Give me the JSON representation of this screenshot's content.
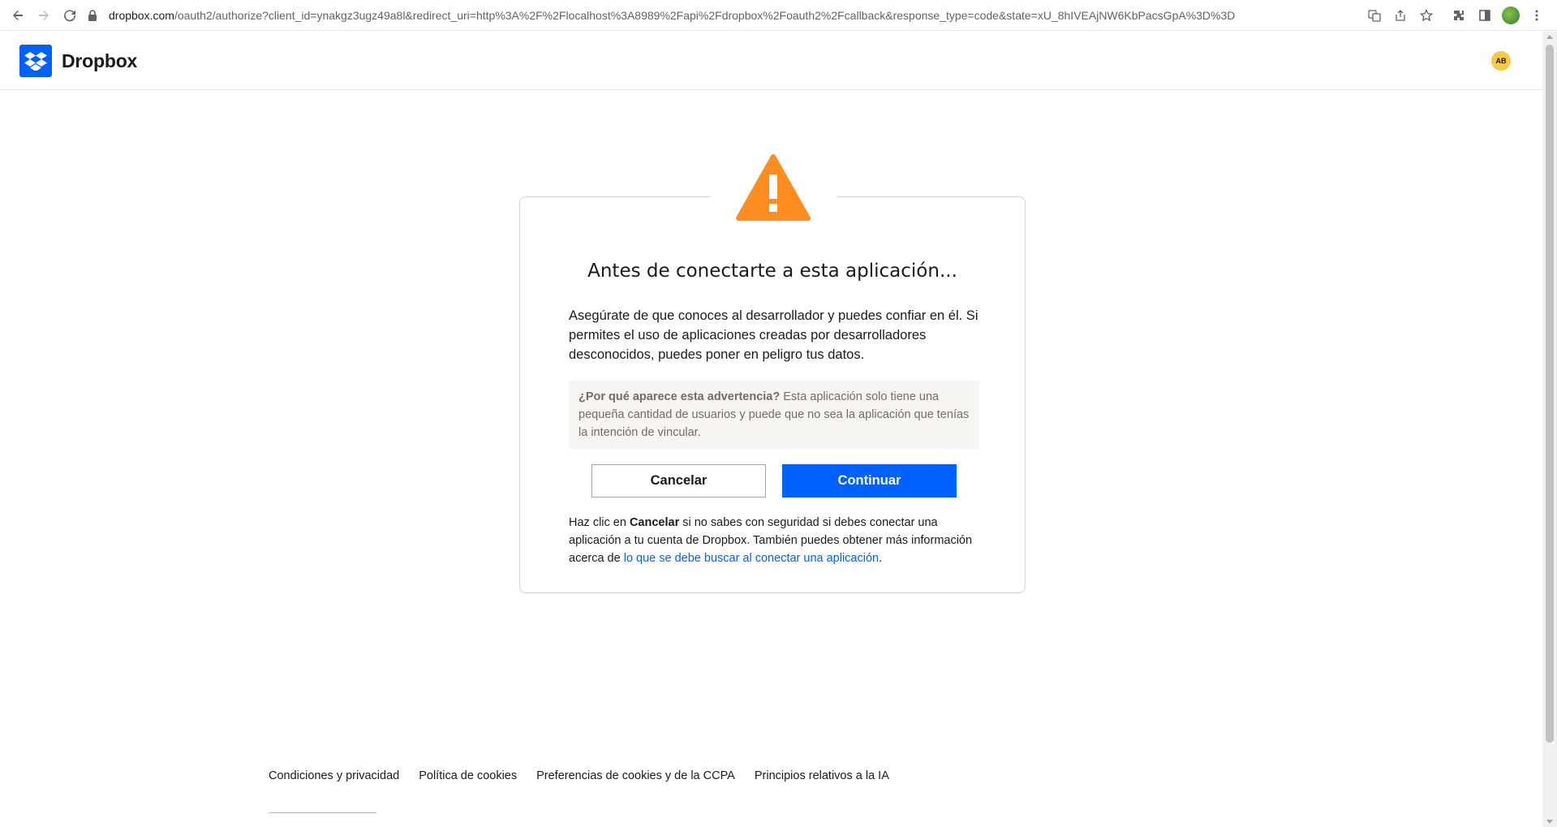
{
  "browser": {
    "url_host": "dropbox.com",
    "url_rest": "/oauth2/authorize?client_id=ynakgz3ugz49a8l&redirect_uri=http%3A%2F%2Flocalhost%3A8989%2Fapi%2Fdropbox%2Foauth2%2Fcallback&response_type=code&state=xU_8hIVEAjNW6KbPacsGpA%3D%3D"
  },
  "header": {
    "brand": "Dropbox",
    "avatar_initials": "AB",
    "brand_color": "#0061fe",
    "avatar_color": "#f7c948"
  },
  "card": {
    "warning_color": "#fe8c21",
    "title": "Antes de conectarte a esta aplicación...",
    "body": "Asegúrate de que conoces al desarrollador y puedes confiar en él. Si permites el uso de aplicaciones creadas por desarrolladores desconocidos, puedes poner en peligro tus datos.",
    "why_label": "¿Por qué aparece esta advertencia?",
    "why_text": " Esta aplicación solo tiene una pequeña cantidad de usuarios y puede que no sea la aplicación que tenías la intención de vincular.",
    "cancel_label": "Cancelar",
    "continue_label": "Continuar",
    "foot_prefix": "Haz clic en ",
    "foot_bold": "Cancelar",
    "foot_middle": " si no sabes con seguridad si debes conectar una aplicación a tu cuenta de Dropbox. También puedes obtener más información acerca de ",
    "foot_link": "lo que se debe buscar al conectar una aplicación",
    "foot_suffix": "."
  },
  "footer": {
    "links": [
      "Condiciones y privacidad",
      "Política de cookies",
      "Preferencias de cookies y de la CCPA",
      "Principios relativos a la IA"
    ]
  }
}
